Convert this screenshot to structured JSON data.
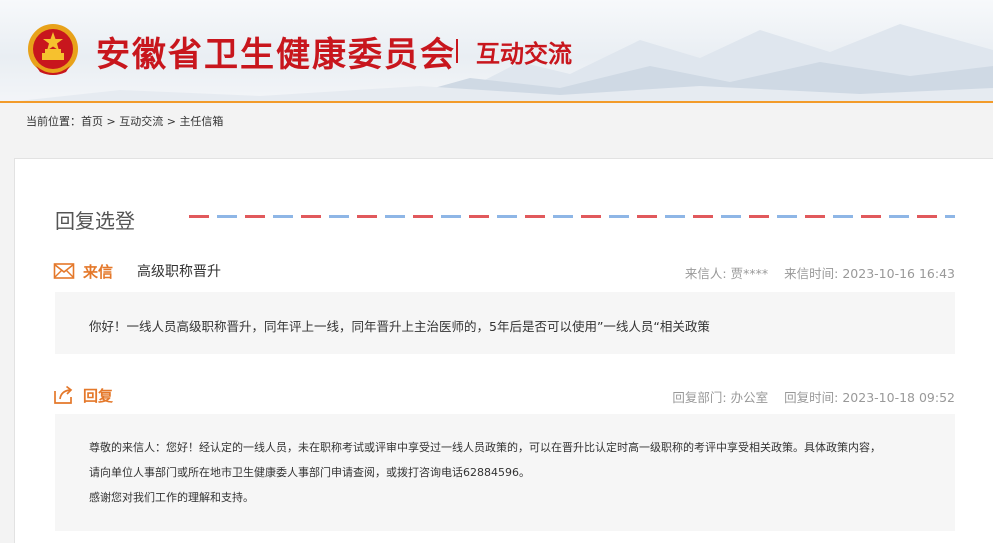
{
  "header": {
    "site_title": "安徽省卫生健康委员会",
    "section_title": "互动交流",
    "brand_color": "#c8161d",
    "accent_color": "#f29b2a"
  },
  "breadcrumb": {
    "prefix": "当前位置：",
    "items": [
      "首页",
      "互动交流",
      "主任信箱"
    ],
    "separator": " > "
  },
  "panel": {
    "heading": "回复选登"
  },
  "letter": {
    "icon": "envelope-icon",
    "kind_label": "来信",
    "subject": "高级职称晋升",
    "sender_label": "来信人:",
    "sender": "贾****",
    "time_label": "来信时间:",
    "time": "2023-10-16 16:43",
    "body": "你好！一线人员高级职称晋升，同年评上一线，同年晋升上主治医师的，5年后是否可以使用”一线人员“相关政策"
  },
  "reply": {
    "icon": "share-reply-icon",
    "kind_label": "回复",
    "dept_label": "回复部门:",
    "dept": "办公室",
    "time_label": "回复时间:",
    "time": "2023-10-18 09:52",
    "lines": [
      "尊敬的来信人：您好！经认定的一线人员，未在职称考试或评审中享受过一线人员政策的，可以在晋升比认定时高一级职称的考评中享受相关政策。具体政策内容，",
      "请向单位人事部门或所在地市卫生健康委人事部门申请查阅，或拨打咨询电话62884596。",
      "感谢您对我们工作的理解和支持。"
    ]
  }
}
